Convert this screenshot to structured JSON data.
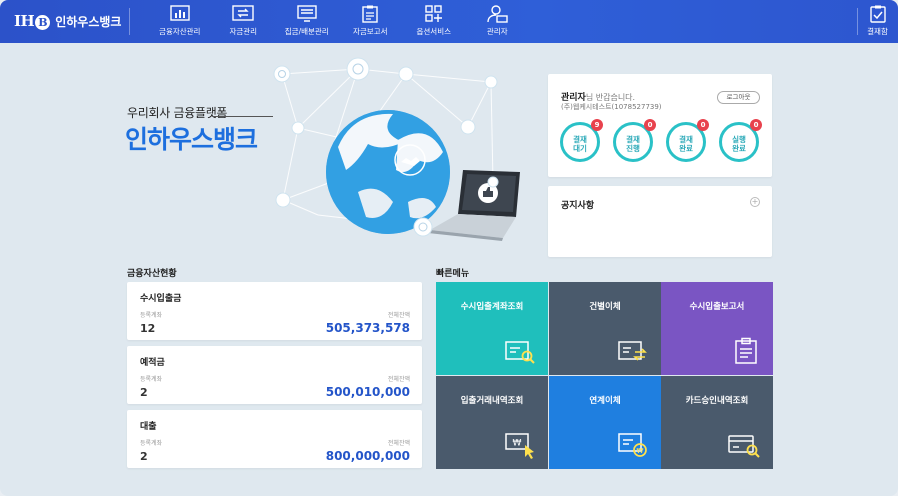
{
  "brand": {
    "logo_text": "IH",
    "logo_b": "B",
    "name": "인하우스뱅크"
  },
  "nav": [
    {
      "label": "금융자산관리",
      "icon": "chart-board-icon"
    },
    {
      "label": "자금관리",
      "icon": "transfer-icon"
    },
    {
      "label": "집금/배분관리",
      "icon": "monitor-icon"
    },
    {
      "label": "자금보고서",
      "icon": "report-icon"
    },
    {
      "label": "옵션서비스",
      "icon": "grid-plus-icon"
    },
    {
      "label": "관리자",
      "icon": "admin-user-icon"
    }
  ],
  "approval": {
    "label": "결재함",
    "icon": "approval-check-icon"
  },
  "hero": {
    "subtitle": "우리회사 금융플랫폼",
    "title": "인하우스뱅크"
  },
  "admin": {
    "name": "관리자",
    "greeting_suffix": "님 반갑습니다.",
    "company": "(주)웹케시테스트(1078527739)",
    "logout_label": "로그아웃",
    "statuses": [
      {
        "line1": "결재",
        "line2": "대기",
        "count": "9"
      },
      {
        "line1": "결재",
        "line2": "진행",
        "count": "0"
      },
      {
        "line1": "결재",
        "line2": "완료",
        "count": "0"
      },
      {
        "line1": "실행",
        "line2": "완료",
        "count": "0"
      }
    ]
  },
  "notice": {
    "title": "공지사항",
    "plus": "+"
  },
  "assets": {
    "title": "금융자산현황",
    "items": [
      {
        "name": "수시입출금",
        "count_label": "등록계좌",
        "count": "12",
        "balance_label": "전체잔액",
        "balance": "505,373,578"
      },
      {
        "name": "예적금",
        "count_label": "등록계좌",
        "count": "2",
        "balance_label": "전체잔액",
        "balance": "500,010,000"
      },
      {
        "name": "대출",
        "count_label": "등록계좌",
        "count": "2",
        "balance_label": "전체잔액",
        "balance": "800,000,000"
      }
    ]
  },
  "quick": {
    "title": "빠른메뉴",
    "tiles": [
      {
        "label": "수시입출계좌조회",
        "color": "#1fbfbc",
        "icon": "account-search-icon"
      },
      {
        "label": "건별이체",
        "color": "#4a5a6c",
        "icon": "single-transfer-icon"
      },
      {
        "label": "수시입출보고서",
        "color": "#7a55c3",
        "icon": "clipboard-report-icon"
      },
      {
        "label": "입출거래내역조회",
        "color": "#4a5a6c",
        "icon": "won-click-icon"
      },
      {
        "label": "연계이체",
        "color": "#1f7fe0",
        "icon": "linked-transfer-icon"
      },
      {
        "label": "카드승인내역조회",
        "color": "#4a5a6c",
        "icon": "card-search-icon"
      }
    ]
  },
  "colors": {
    "header": "#2c52c9",
    "accent": "#1d6fde",
    "teal": "#2ac1c7",
    "badge": "#e8424d"
  }
}
